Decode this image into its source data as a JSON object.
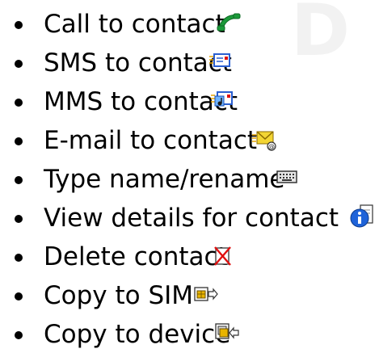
{
  "watermark": "D",
  "menu": {
    "items": [
      {
        "label": "Call to contact",
        "icon": "green-phone-icon"
      },
      {
        "label": "SMS to contact",
        "icon": "sms-message-icon"
      },
      {
        "label": "MMS to contact",
        "icon": "mms-message-icon"
      },
      {
        "label": "E-mail to contact",
        "icon": "email-envelope-icon"
      },
      {
        "label": "Type name/rename",
        "icon": "keyboard-icon"
      },
      {
        "label": "View details for contact",
        "icon": "info-details-icon"
      },
      {
        "label": "Delete contact",
        "icon": "delete-cross-icon"
      },
      {
        "label": "Copy to SIM",
        "icon": "copy-to-sim-icon"
      },
      {
        "label": "Copy to device",
        "icon": "copy-to-device-icon"
      }
    ]
  },
  "colors": {
    "text": "#000000",
    "phone_green": "#1c9a3a",
    "sms_blue": "#2a5fd1",
    "delete_red": "#e01010",
    "envelope_yellow": "#f3d533",
    "info_blue": "#1f63d9"
  }
}
